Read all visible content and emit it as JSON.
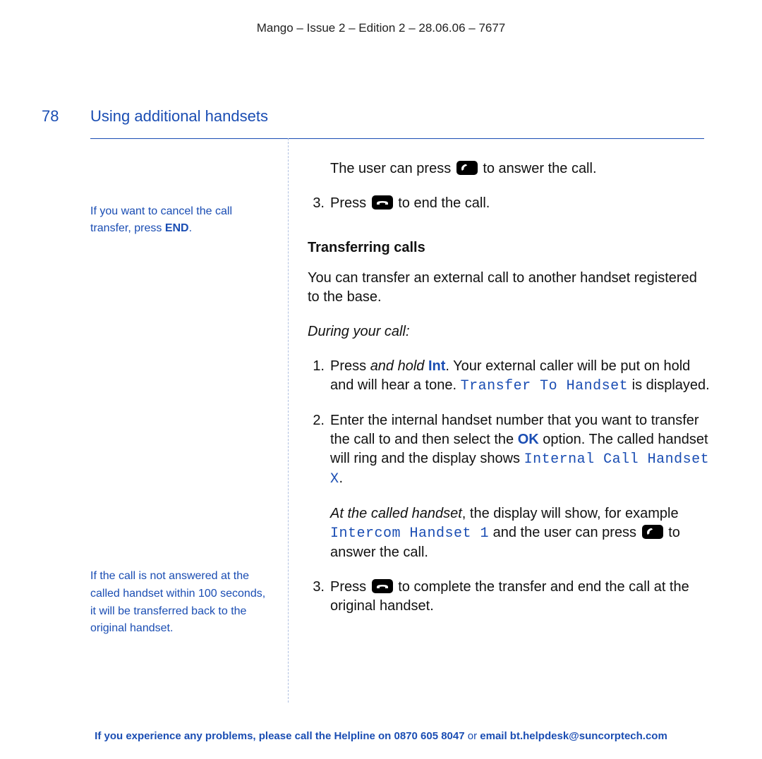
{
  "header": "Mango – Issue 2 – Edition 2 – 28.06.06 – 7677",
  "page_number": "78",
  "section_title": "Using additional handsets",
  "side_notes": {
    "note1_pre": "If you want to cancel the call transfer, press ",
    "note1_bold": "END",
    "note1_post": ".",
    "note2": "If the call is not answered at the called handset within 100 seconds, it will be transferred back to the original handset."
  },
  "main": {
    "line1_pre": "The user can press ",
    "line1_post": " to answer the call.",
    "step3a_num": "3.",
    "step3a_pre": "Press ",
    "step3a_post": " to end the call.",
    "subhead": "Transferring calls",
    "p1": "You can transfer an external call to another handset registered to the base.",
    "p2_italic": "During your call:",
    "step1_num": "1.",
    "step1_a": "Press ",
    "step1_b_italic": "and hold ",
    "step1_b_bold": "Int",
    "step1_c": ". Your external caller will be put on hold and will hear a tone. ",
    "step1_display": "Transfer To Handset",
    "step1_d": " is displayed.",
    "step2_num": "2.",
    "step2_a": "Enter the internal handset number that you want to transfer the call to and then select the ",
    "step2_bold": "OK",
    "step2_b": " option. The called handset will ring and the display shows ",
    "step2_display": "Internal Call Handset X",
    "step2_c": ".",
    "p3_a_italic": "At the called handset",
    "p3_b": ", the display will show, for example ",
    "p3_display": "Intercom Handset 1",
    "p3_c": " and the user can press ",
    "p3_d": " to answer the call.",
    "step3b_num": "3.",
    "step3b_pre": "Press ",
    "step3b_post": " to complete the transfer and end the call at the original handset."
  },
  "footer": {
    "a": "If you experience any problems, please call the Helpline on ",
    "phone": "0870 605 8047",
    "b": " or ",
    "email": "email bt.helpdesk@suncorptech.com"
  }
}
